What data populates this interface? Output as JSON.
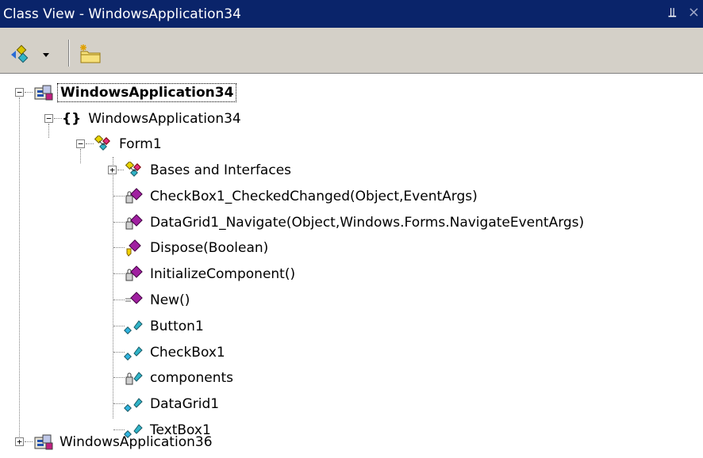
{
  "window": {
    "title": "Class View - WindowsApplication34",
    "pin_glyph": "ꟸ",
    "close_glyph": "×"
  },
  "toolbar": {
    "sort_button_icon": "sort-by-type-icon",
    "new_folder_button_icon": "new-folder-icon"
  },
  "tree": {
    "project1": "WindowsApplication34",
    "namespace1": "WindowsApplication34",
    "class1": "Form1",
    "members": [
      {
        "label": "Bases and Interfaces",
        "icon": "bases-interfaces-icon"
      },
      {
        "label": "CheckBox1_CheckedChanged(Object,EventArgs)",
        "icon": "protected-method-icon"
      },
      {
        "label": "DataGrid1_Navigate(Object,Windows.Forms.NavigateEventArgs)",
        "icon": "protected-method-icon"
      },
      {
        "label": "Dispose(Boolean)",
        "icon": "override-method-icon"
      },
      {
        "label": "InitializeComponent()",
        "icon": "private-method-icon"
      },
      {
        "label": "New()",
        "icon": "public-method-icon"
      },
      {
        "label": "Button1",
        "icon": "friend-field-icon"
      },
      {
        "label": "CheckBox1",
        "icon": "friend-field-icon"
      },
      {
        "label": "components",
        "icon": "private-field-icon"
      },
      {
        "label": "DataGrid1",
        "icon": "friend-field-icon"
      },
      {
        "label": "TextBox1",
        "icon": "friend-field-icon"
      }
    ],
    "project2": "WindowsApplication36"
  }
}
